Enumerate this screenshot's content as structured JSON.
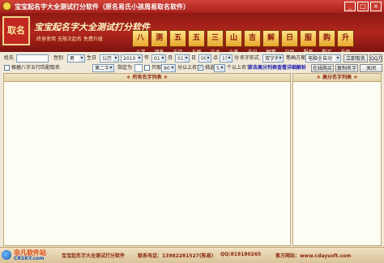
{
  "window": {
    "title": "宝宝起名字大全测试打分软件（原名易氏小孩周易取名软件）",
    "min": "_",
    "max": "□",
    "close": "×"
  },
  "banner": {
    "logo_text": "取名",
    "slogan": "宝宝起名字大全测试打分软件",
    "subtitle": "终身使用 无限次起名 免费升级"
  },
  "nav": [
    {
      "glyph": "八",
      "label": "八字",
      "icon": "bazi-icon"
    },
    {
      "glyph": "测",
      "label": "测名",
      "icon": "test-name-icon"
    },
    {
      "glyph": "五",
      "label": "五行",
      "icon": "wuxing-icon"
    },
    {
      "glyph": "五",
      "label": "五格",
      "icon": "wuge-icon"
    },
    {
      "glyph": "三",
      "label": "三才",
      "icon": "sancai-icon"
    },
    {
      "glyph": "山",
      "label": "山名",
      "icon": "shanming-icon"
    },
    {
      "glyph": "吉",
      "label": "吉日",
      "icon": "jiri-icon"
    },
    {
      "glyph": "解",
      "label": "解梦",
      "icon": "jiemeng-icon"
    },
    {
      "glyph": "日",
      "label": "日历",
      "icon": "calendar-icon"
    },
    {
      "glyph": "服",
      "label": "服务",
      "icon": "service-icon"
    },
    {
      "glyph": "购",
      "label": "购买",
      "icon": "buy-icon"
    },
    {
      "glyph": "升",
      "label": "升级",
      "icon": "upgrade-icon"
    }
  ],
  "form": {
    "surname_label": "姓氏",
    "surname_value": "",
    "gender_label": "性别",
    "gender_value": "男",
    "birthday_label": "生日",
    "calendar_value": "公历",
    "year_value": "2010",
    "year_label": "年",
    "month_value": "01",
    "month_label": "月",
    "day_value": "01",
    "day_label": "日",
    "hour_value": "09",
    "hour_label": "点",
    "minute_value": "15",
    "minute_label": "分",
    "name_format_label": "名字形式",
    "name_format_value": "双字名",
    "strokes_label": "笔画方案",
    "strokes_value": "电脑全自动",
    "query_button": "立即取名",
    "qq_button": "QQ方",
    "opt1_label": "根据八字五行匹配取名",
    "opt1_checked": false,
    "opt2_value": "第二字",
    "opt3_label": "指定为",
    "opt4_label": "只取",
    "score_value": "90",
    "score_suffix": "分以上名字",
    "opt5_label": "挑选",
    "opt5_checked": true,
    "list_value": "5",
    "list_suffix": "个以上名字",
    "tip_text": "双击高分列表查看详细解析",
    "online_button": "在线购买",
    "copy_button": "复制名字",
    "close_button": "关闭"
  },
  "panels": {
    "all_names_title": "所有名字列表",
    "high_score_title": "高分名字列表"
  },
  "footer": {
    "brand": "非凡软件站",
    "brand_en": "CRSKY.com",
    "app_name": "宝宝起名字大全测试打分软件",
    "phone": "联系电话：13982281527(陈易)",
    "qq": "QQ:819180265",
    "website": "客方网站：www.cdaysoft.com"
  }
}
